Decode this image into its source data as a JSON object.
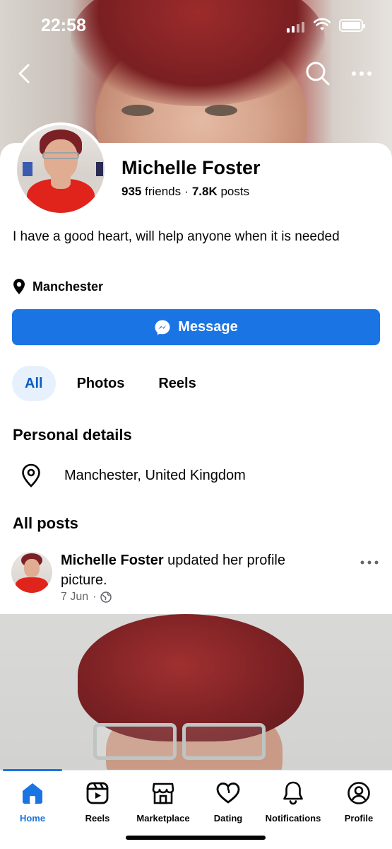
{
  "status_bar": {
    "time": "22:58"
  },
  "profile": {
    "name": "Michelle Foster",
    "friends_count": "935",
    "friends_label": "friends",
    "separator": "·",
    "posts_count": "7.8K",
    "posts_label": "posts",
    "bio": "I have a good heart, will help anyone when it is needed",
    "location": "Manchester"
  },
  "message_button": {
    "label": "Message"
  },
  "tabs": [
    {
      "label": "All",
      "active": true
    },
    {
      "label": "Photos",
      "active": false
    },
    {
      "label": "Reels",
      "active": false
    }
  ],
  "personal_details": {
    "heading": "Personal details",
    "location": "Manchester, United Kingdom"
  },
  "posts": {
    "heading": "All posts",
    "items": [
      {
        "author": "Michelle Foster",
        "action": "updated her profile picture.",
        "date": "7 Jun",
        "separator": "·",
        "privacy_icon": "globe-icon"
      }
    ]
  },
  "bottom_nav": [
    {
      "label": "Home",
      "icon": "home-icon",
      "active": true
    },
    {
      "label": "Reels",
      "icon": "reels-icon",
      "active": false
    },
    {
      "label": "Marketplace",
      "icon": "marketplace-icon",
      "active": false
    },
    {
      "label": "Dating",
      "icon": "dating-icon",
      "active": false
    },
    {
      "label": "Notifications",
      "icon": "bell-icon",
      "active": false
    },
    {
      "label": "Profile",
      "icon": "profile-icon",
      "active": false
    }
  ],
  "colors": {
    "accent": "#1b74e4",
    "tab_active_bg": "#e7f1fd",
    "text_primary": "#050505",
    "text_secondary": "#65676b"
  }
}
